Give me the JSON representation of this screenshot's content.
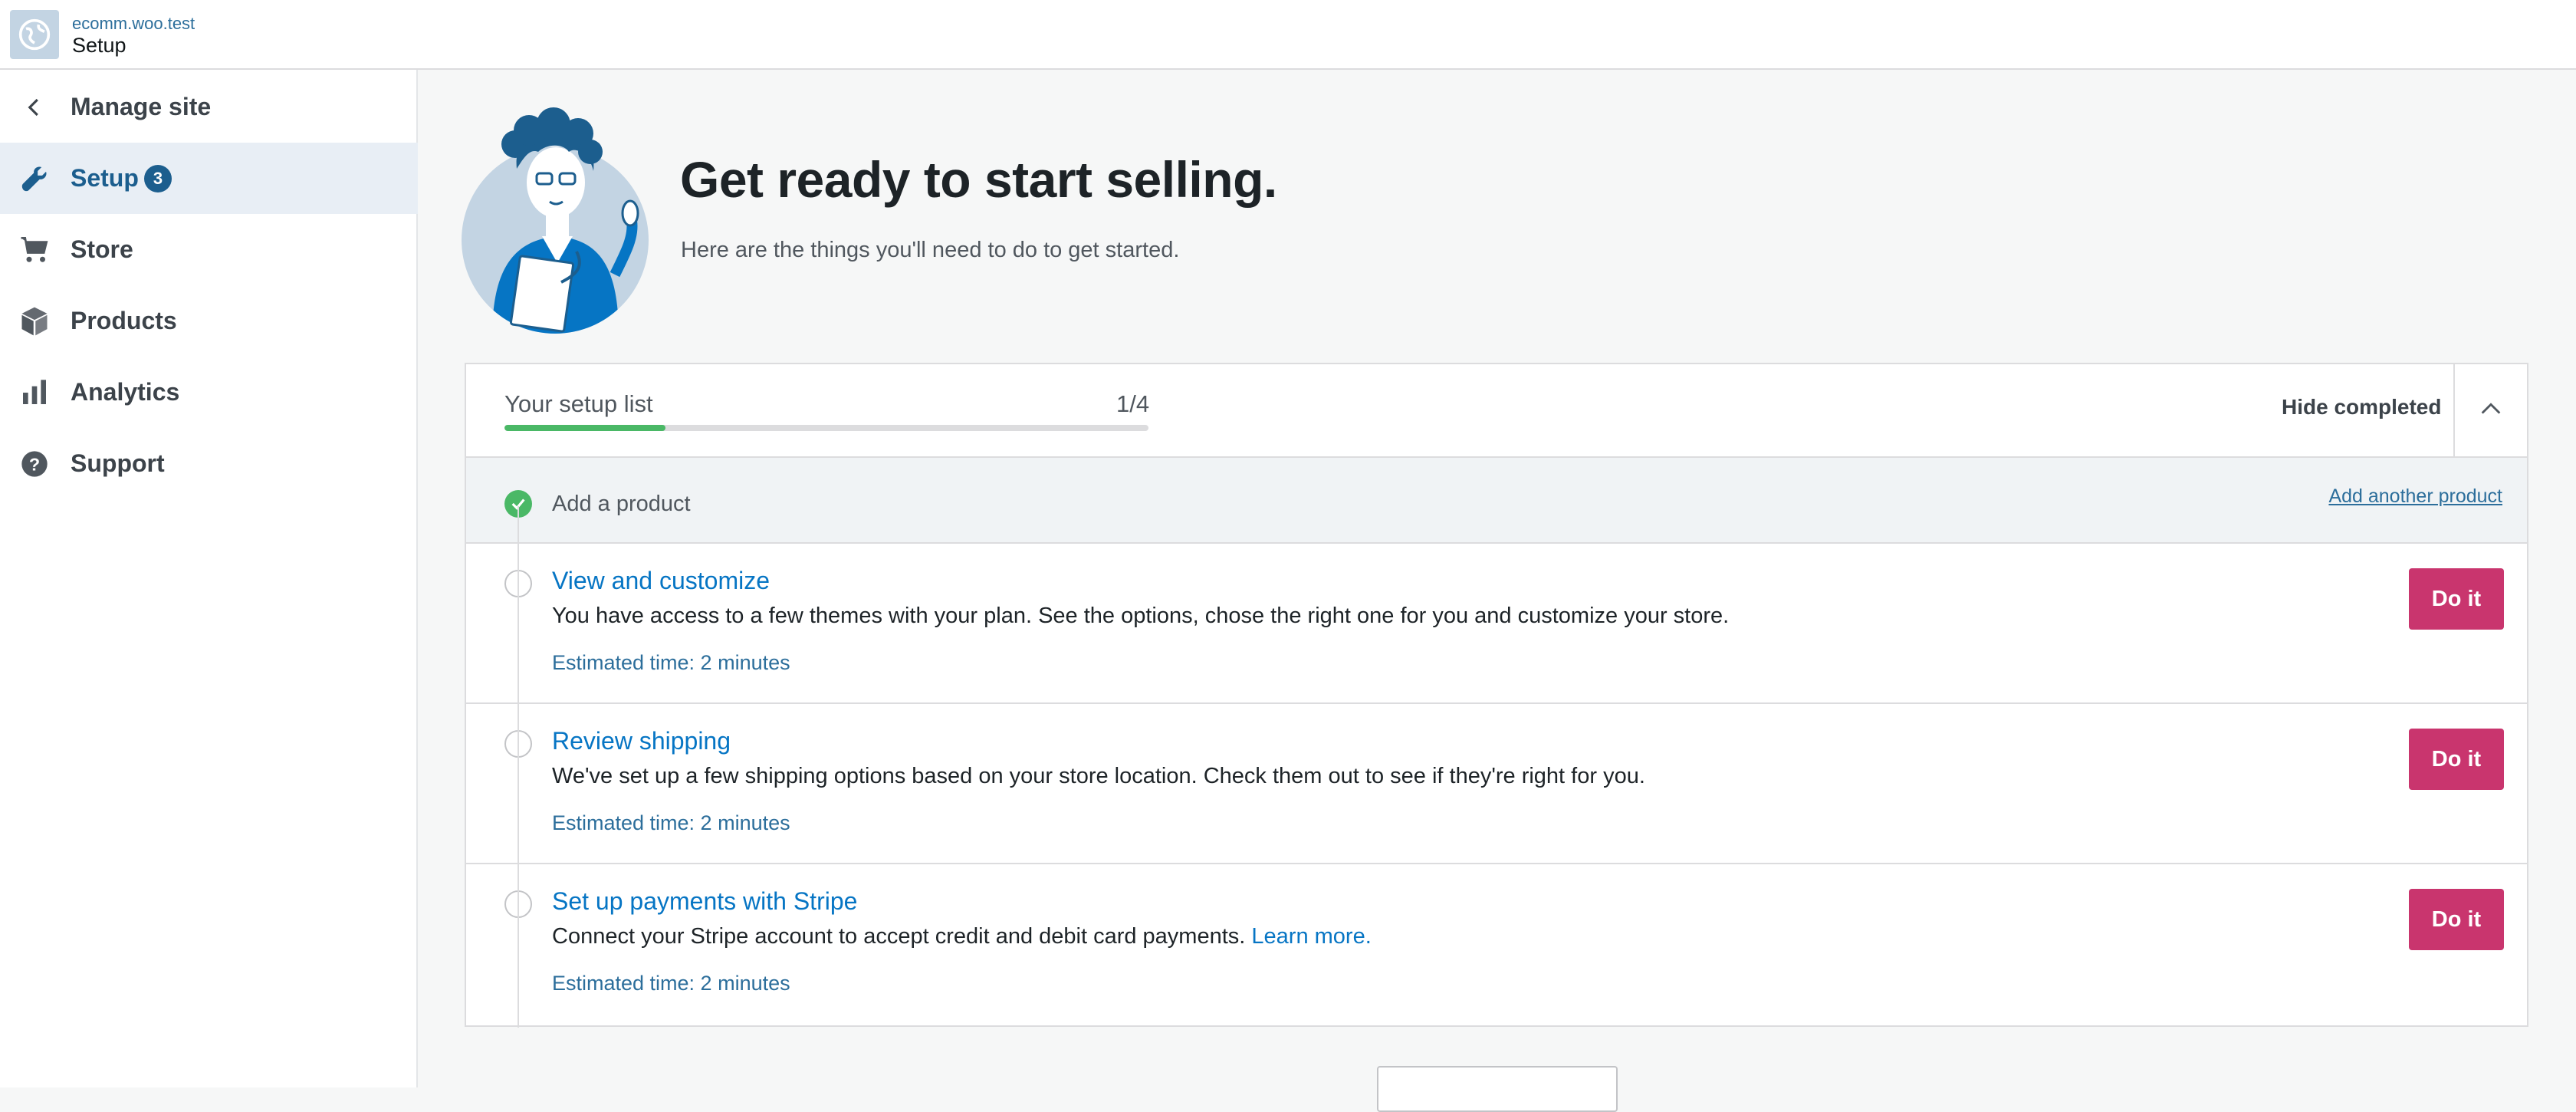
{
  "masterbar": {
    "site_domain": "ecomm.woo.test",
    "site_title": "Setup"
  },
  "sidebar": {
    "items": [
      {
        "label": "Manage site",
        "icon": "chevron-left-icon"
      },
      {
        "label": "Setup",
        "icon": "wrench-icon",
        "badge": "3",
        "active": true
      },
      {
        "label": "Store",
        "icon": "cart-icon"
      },
      {
        "label": "Products",
        "icon": "box-icon"
      },
      {
        "label": "Analytics",
        "icon": "bar-chart-icon"
      },
      {
        "label": "Support",
        "icon": "help-icon"
      }
    ]
  },
  "header": {
    "title": "Get ready to start selling.",
    "subtitle": "Here are the things you'll need to do to get started."
  },
  "checklist": {
    "label": "Your setup list",
    "count": "1/4",
    "progress_fraction": 0.25,
    "hide_completed_label": "Hide completed",
    "completed": {
      "title": "Add a product",
      "action_label": "Add another product"
    },
    "tasks": [
      {
        "title": "View and customize",
        "description": "You have access to a few themes with your plan. See the options, chose the right one for you and customize your store.",
        "time": "Estimated time: 2 minutes",
        "button": "Do it"
      },
      {
        "title": "Review shipping",
        "description": "We've set up a few shipping options based on your store location. Check them out to see if they're right for you.",
        "time": "Estimated time: 2 minutes",
        "button": "Do it"
      },
      {
        "title": "Set up payments with Stripe",
        "description": "Connect your Stripe account to accept credit and debit card payments.",
        "link": "Learn more.",
        "time": "Estimated time: 2 minutes",
        "button": "Do it"
      }
    ]
  },
  "colors": {
    "accent_pink": "#c9356e",
    "link_blue": "#0675c4",
    "success_green": "#4ab866",
    "active_nav_bg": "#e8eef5"
  }
}
